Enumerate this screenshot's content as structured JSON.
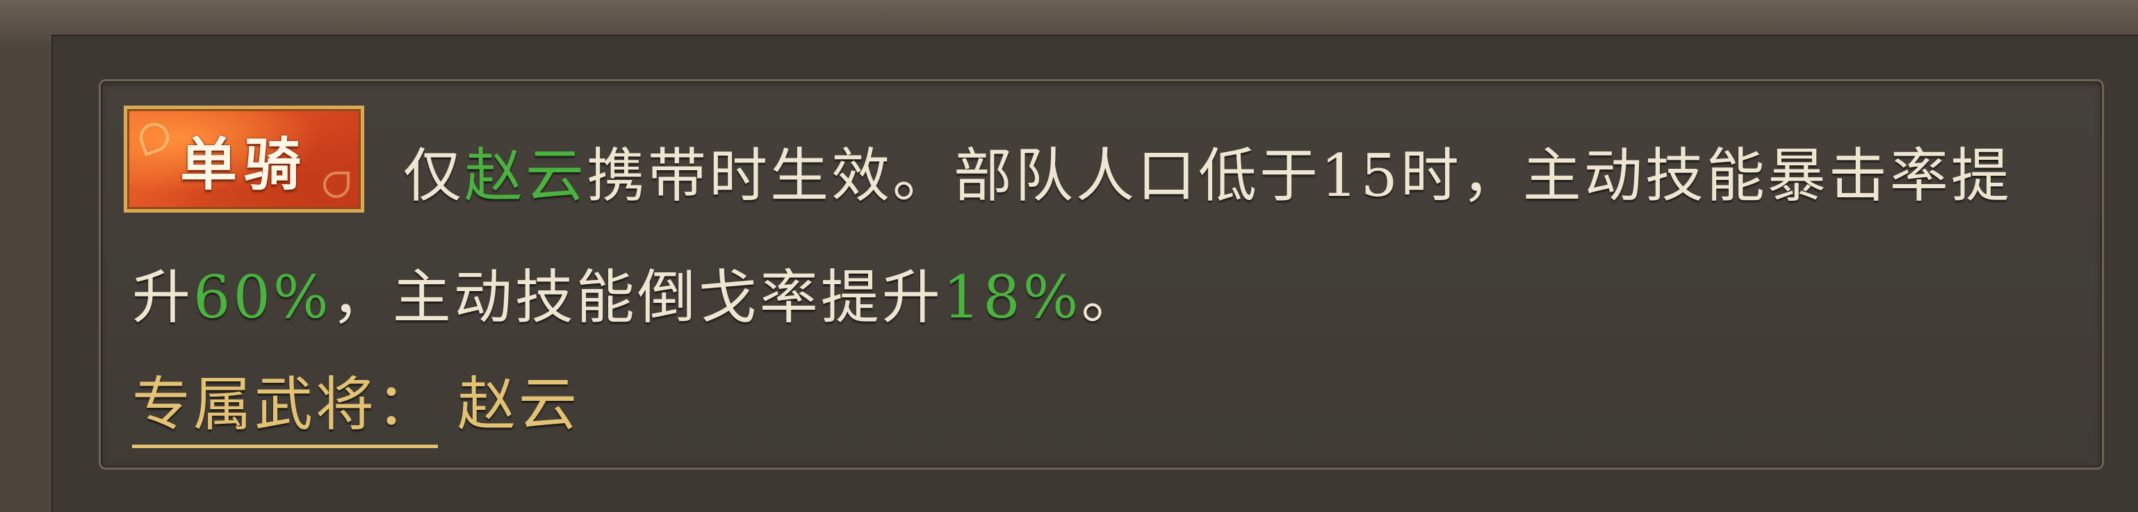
{
  "skill": {
    "tag_label": "单骑",
    "description": {
      "pre_hero": "仅",
      "hero_name": "赵云",
      "mid_text": "携带时生效。部队人口低于15时，主动技能暴击率提升",
      "crit_value": "60%",
      "mid_text_2": "，主动技能倒戈率提升",
      "defect_value": "18%",
      "end_text": "。"
    },
    "exclusive_label": "专属武将：",
    "exclusive_hero": "赵云"
  },
  "colors": {
    "highlight_green": "#4ab23f",
    "body_text": "#efe6d2",
    "gold_text": "#e3c274",
    "tag_orange": "#da4c20"
  }
}
